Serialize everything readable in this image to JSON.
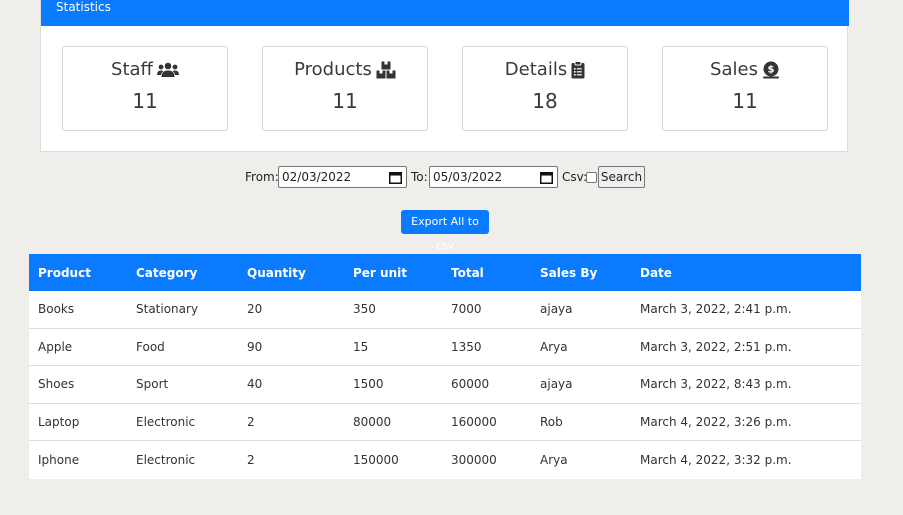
{
  "stats": {
    "header": "Statistics",
    "cards": [
      {
        "title": "Staff",
        "icon": "users-icon",
        "value": "11"
      },
      {
        "title": "Products",
        "icon": "boxes-icon",
        "value": "11"
      },
      {
        "title": "Details",
        "icon": "clipboard-icon",
        "value": "18"
      },
      {
        "title": "Sales",
        "icon": "money-bag-icon",
        "value": "11"
      }
    ]
  },
  "filter": {
    "from_label": "From:",
    "from_value": "02/03/2022",
    "to_label": "To:",
    "to_value": "05/03/2022",
    "csv_label": "Csv:",
    "csv_checked": false,
    "search_label": "Search"
  },
  "export_label": "Export All to csv",
  "table": {
    "headers": [
      "Product",
      "Category",
      "Quantity",
      "Per unit",
      "Total",
      "Sales By",
      "Date"
    ],
    "rows": [
      [
        "Books",
        "Stationary",
        "20",
        "350",
        "7000",
        "ajaya",
        "March 3, 2022, 2:41 p.m."
      ],
      [
        "Apple",
        "Food",
        "90",
        "15",
        "1350",
        "Arya",
        "March 3, 2022, 2:51 p.m."
      ],
      [
        "Shoes",
        "Sport",
        "40",
        "1500",
        "60000",
        "ajaya",
        "March 3, 2022, 8:43 p.m."
      ],
      [
        "Laptop",
        "Electronic",
        "2",
        "80000",
        "160000",
        "Rob",
        "March 4, 2022, 3:26 p.m."
      ],
      [
        "Iphone",
        "Electronic",
        "2",
        "150000",
        "300000",
        "Arya",
        "March 4, 2022, 3:32 p.m."
      ]
    ]
  },
  "colors": {
    "primary": "#0a7aff",
    "background": "#efeeeb"
  }
}
